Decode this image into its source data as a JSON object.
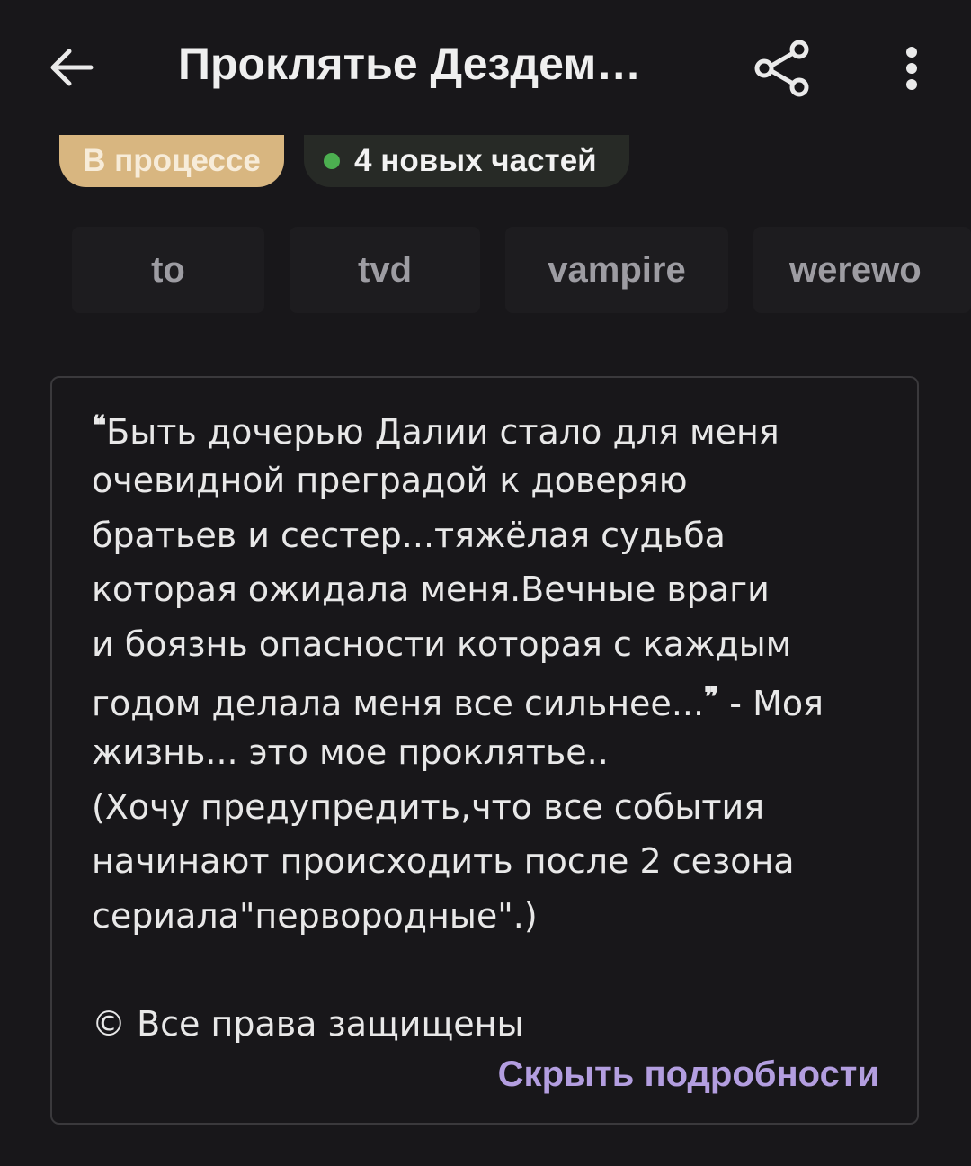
{
  "header": {
    "title": "Проклятье Дездем…",
    "back_icon": "arrow-left-icon",
    "share_icon": "share-icon",
    "more_icon": "more-vertical-icon"
  },
  "badges": {
    "status_label": "В процессе",
    "new_parts_label": "4 новых частей",
    "status_color": "#d8b680",
    "new_dot_color": "#4caf50"
  },
  "tags": [
    "to",
    "tvd",
    "vampire",
    "werewo"
  ],
  "description": {
    "open_quote": "❝",
    "close_quote": "❞",
    "line1": "Быть дочерью Далии стало для меня",
    "line2": "очевидной преградой к доверяю",
    "line3": "братьев и сестер...тяжёлая судьба",
    "line4": "которая ожидала меня.Вечные враги",
    "line5": "и боязнь опасности которая с каждым",
    "line6_a": "годом делала меня все сильнее...",
    "line6_b": " - Моя",
    "line7": "жизнь... это мое проклятье..",
    "line8": "(Хочу предупредить,что все события",
    "line9": "начинают происходить после 2 сезона",
    "line10": "сериала\"первородные\".)",
    "copyright": "© Все права защищены"
  },
  "hide_details_label": "Скрыть подробности",
  "accent_color": "#b39ee0"
}
